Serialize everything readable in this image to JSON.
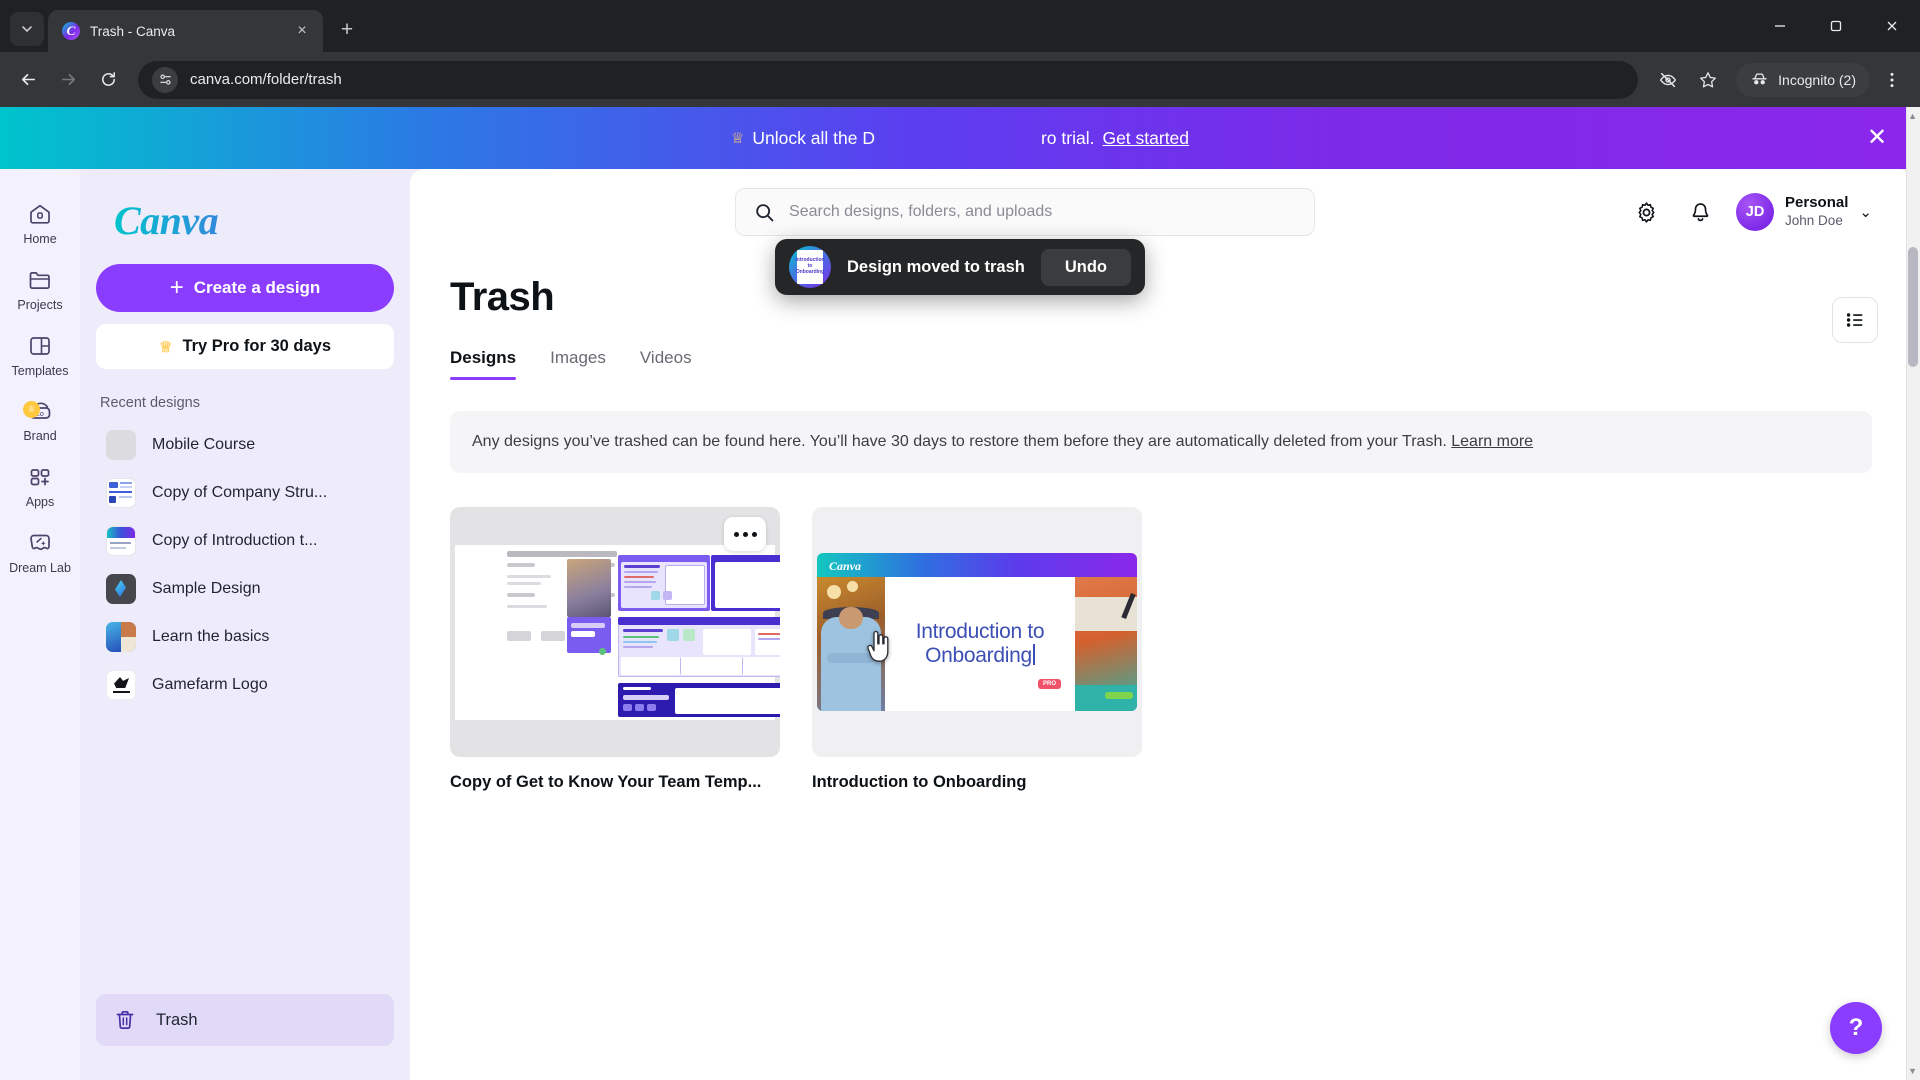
{
  "browser": {
    "tab": {
      "title": "Trash - Canva",
      "favicon": "canva-icon",
      "close": "×"
    },
    "new_tab": "+",
    "tab_list": "v",
    "window": {
      "minimize": "—",
      "maximize": "▢",
      "close": "✕"
    },
    "nav": {
      "back": "←",
      "forward": "→",
      "reload": "⟳"
    },
    "url": "canva.com/folder/trash",
    "site_settings_icon": "tune-icon",
    "eye_off_icon": "eye-off-icon",
    "bookmark_icon": "star-icon",
    "incognito_label": "Incognito (2)",
    "menu_icon": "kebab-menu-icon"
  },
  "promo": {
    "crown": "♕",
    "text_before": "Unlock all the D",
    "text_after": "ro trial.",
    "cta": "Get started",
    "close": "✕"
  },
  "toast": {
    "message": "Design moved to trash",
    "undo_label": "Undo",
    "thumb_caption": "Introduction to Onboarding"
  },
  "rail": {
    "items": [
      {
        "label": "Home",
        "icon": "home-icon"
      },
      {
        "label": "Projects",
        "icon": "folder-icon"
      },
      {
        "label": "Templates",
        "icon": "templates-icon"
      },
      {
        "label": "Brand",
        "icon": "brand-icon",
        "badge": "♕"
      },
      {
        "label": "Apps",
        "icon": "apps-icon"
      },
      {
        "label": "Dream Lab",
        "icon": "dream-lab-icon"
      }
    ]
  },
  "sidebar": {
    "logo": "Canva",
    "create_button": "Create a design",
    "create_plus": "+",
    "try_pro": "Try Pro for 30 days",
    "try_pro_crown": "♕",
    "recent_title": "Recent designs",
    "recent": [
      {
        "label": "Mobile Course",
        "thumb": "blank-grey"
      },
      {
        "label": "Copy of Company Stru...",
        "thumb": "document-blue"
      },
      {
        "label": "Copy of Introduction t...",
        "thumb": "presentation-teal"
      },
      {
        "label": "Sample Design",
        "thumb": "dark-logo"
      },
      {
        "label": "Learn the basics",
        "thumb": "blue-collage"
      },
      {
        "label": "Gamefarm Logo",
        "thumb": "white-logo"
      }
    ],
    "trash": {
      "label": "Trash",
      "icon": "trash-icon"
    }
  },
  "header": {
    "search_placeholder": "Search designs, folders, and uploads",
    "search_value": "",
    "search_icon": "search-icon",
    "settings_icon": "gear-icon",
    "notifications_icon": "bell-icon",
    "avatar_initials": "JD",
    "plan": "Personal",
    "user_name": "John Doe",
    "chevron": "⌄"
  },
  "page": {
    "title": "Trash",
    "view_toggle_icon": "list-view-icon",
    "tabs": [
      {
        "label": "Designs",
        "active": true
      },
      {
        "label": "Images",
        "active": false
      },
      {
        "label": "Videos",
        "active": false
      }
    ],
    "info_text": "Any designs you’ve trashed can be found here. You’ll have 30 days to restore them before they are automatically deleted from your Trash.",
    "info_link": "Learn more",
    "designs": [
      {
        "name": "Copy of Get to Know Your Team Temp...",
        "thumb_type": "whiteboard",
        "has_menu": true,
        "menu_icon": "more-options-icon"
      },
      {
        "name": "Introduction to Onboarding",
        "thumb_type": "presentation",
        "thumb_title_line1": "Introduction to",
        "thumb_title_line2": "Onboarding",
        "thumb_logo": "Canva",
        "thumb_badge": "PRO",
        "has_menu": false
      }
    ],
    "help_label": "?"
  },
  "colors": {
    "brand_purple": "#8b3dff",
    "sidebar_bg": "#eeecfb",
    "rail_bg": "#f2f1fd",
    "trash_active_bg": "#e0daf8",
    "banner_gradient_start": "#00c4cc",
    "banner_gradient_end": "#8b27ea",
    "toast_bg": "#252627",
    "chrome_bg": "#35363a"
  }
}
